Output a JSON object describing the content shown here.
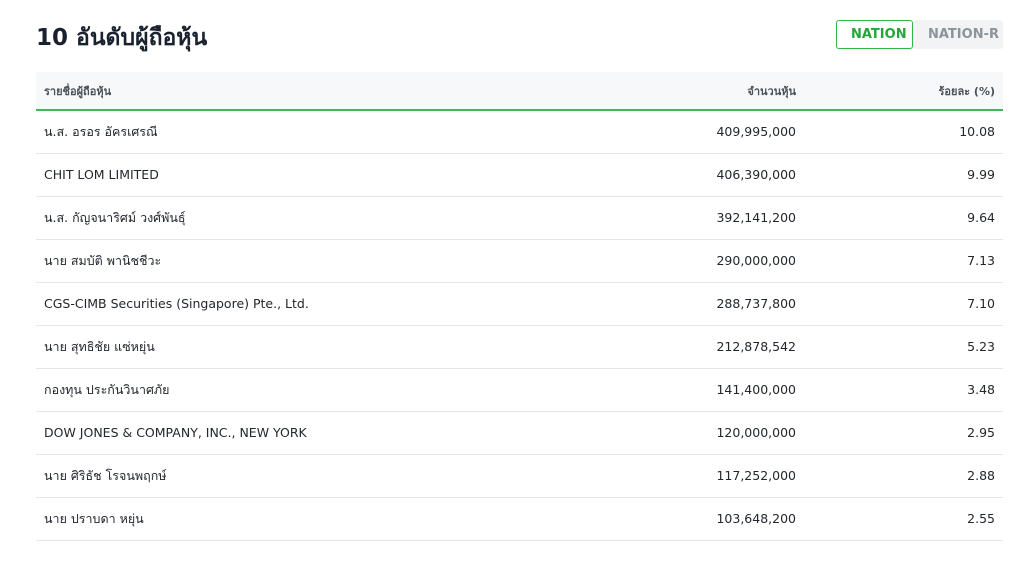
{
  "header": {
    "title": "10 อันดับผู้ถือหุ้น",
    "tabs": [
      {
        "label": "NATION",
        "active": true
      },
      {
        "label": "NATION-R",
        "active": false
      }
    ]
  },
  "table": {
    "columns": [
      "รายชื่อผู้ถือหุ้น",
      "จำนวนหุ้น",
      "ร้อยละ (%)"
    ],
    "rows": [
      {
        "name": "น.ส. อรอร อัครเศรณี",
        "shares": "409,995,000",
        "percent": "10.08"
      },
      {
        "name": "CHIT LOM LIMITED",
        "shares": "406,390,000",
        "percent": "9.99"
      },
      {
        "name": "น.ส. กัญจนาริศม์ วงศ์พันธุ์",
        "shares": "392,141,200",
        "percent": "9.64"
      },
      {
        "name": "นาย สมบัติ พานิชชีวะ",
        "shares": "290,000,000",
        "percent": "7.13"
      },
      {
        "name": "CGS-CIMB Securities (Singapore) Pte., Ltd.",
        "shares": "288,737,800",
        "percent": "7.10"
      },
      {
        "name": "นาย สุทธิชัย แซ่หยุ่น",
        "shares": "212,878,542",
        "percent": "5.23"
      },
      {
        "name": "กองทุน ประกันวินาศภัย",
        "shares": "141,400,000",
        "percent": "3.48"
      },
      {
        "name": "DOW JONES & COMPANY, INC., NEW YORK",
        "shares": "120,000,000",
        "percent": "2.95"
      },
      {
        "name": "นาย ศิริธัช โรจนพฤกษ์",
        "shares": "117,252,000",
        "percent": "2.88"
      },
      {
        "name": "นาย ปราบดา หยุ่น",
        "shares": "103,648,200",
        "percent": "2.55"
      }
    ]
  },
  "colors": {
    "accent": "#34b54a",
    "title": "#1a2230",
    "header_bg": "#f7f8f9",
    "row_divider": "#e4e6e9"
  }
}
